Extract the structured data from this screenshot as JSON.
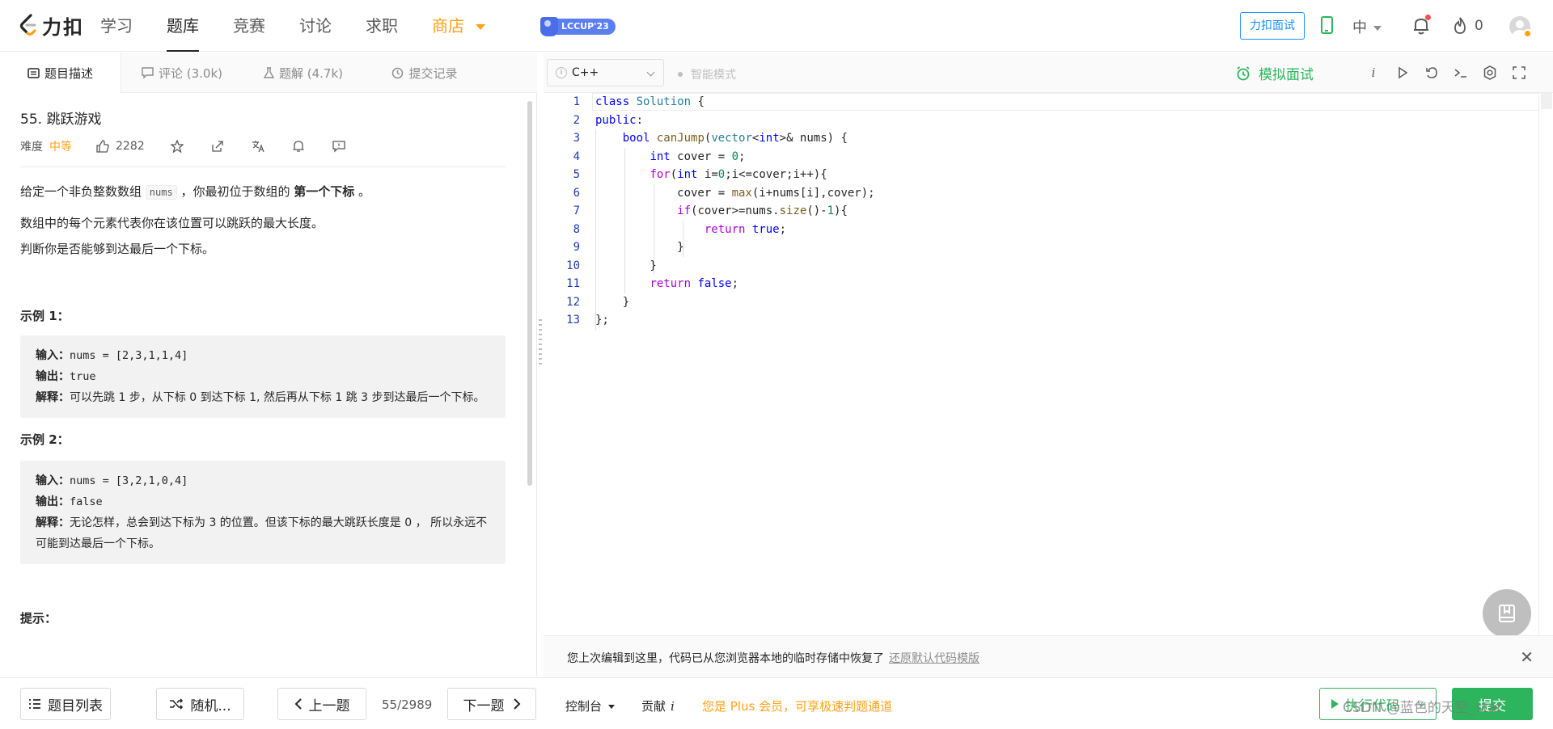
{
  "brand": {
    "name": "力扣"
  },
  "nav": {
    "links": [
      {
        "label": "学习"
      },
      {
        "label": "题库"
      },
      {
        "label": "竞赛"
      },
      {
        "label": "讨论"
      },
      {
        "label": "求职"
      },
      {
        "label": "商店"
      }
    ],
    "active_index": 1,
    "event_badge": "LCCUP'23",
    "interview_button": "力扣面试",
    "language_switch": "中",
    "flame_count": "0"
  },
  "left_tabs": [
    {
      "label": "题目描述",
      "icon": "description-icon"
    },
    {
      "label": "评论 (3.0k)",
      "icon": "comment-icon"
    },
    {
      "label": "题解 (4.7k)",
      "icon": "solution-flask-icon"
    },
    {
      "label": "提交记录",
      "icon": "history-clock-icon"
    }
  ],
  "problem": {
    "title": "55. 跳跃游戏",
    "difficulty_label": "难度",
    "difficulty": "中等",
    "likes": "2282",
    "desc_part1": "给定一个非负整数数组 ",
    "desc_code": "nums",
    "desc_part2": " ，你最初位于数组的 ",
    "desc_bold": "第一个下标",
    "desc_part3": " 。",
    "desc_line2": "数组中的每个元素代表你在该位置可以跳跃的最大长度。",
    "desc_line3": "判断你是否能够到达最后一个下标。",
    "examples": [
      {
        "title": "示例 1：",
        "input_label": "输入：",
        "input_value": "nums = [2,3,1,1,4]",
        "output_label": "输出：",
        "output_value": "true",
        "explain_label": "解释：",
        "explain_value": "可以先跳 1 步，从下标 0 到达下标 1, 然后再从下标 1 跳 3 步到达最后一个下标。"
      },
      {
        "title": "示例 2：",
        "input_label": "输入：",
        "input_value": "nums = [3,2,1,0,4]",
        "output_label": "输出：",
        "output_value": "false",
        "explain_label": "解释：",
        "explain_value": "无论怎样，总会到达下标为 3 的位置。但该下标的最大跳跃长度是 0 ， 所以永远不可能到达最后一个下标。"
      }
    ],
    "hints_title": "提示："
  },
  "editor": {
    "language": "C++",
    "smart_mode": "智能模式",
    "mock_interview": "模拟面试",
    "notice_text": "您上次编辑到这里，代码已从您浏览器本地的临时存储中恢复了",
    "notice_link": "还原默认代码模版"
  },
  "code_lines": [
    "class Solution {",
    "public:",
    "    bool canJump(vector<int>& nums) {",
    "        int cover = 0;",
    "        for(int i=0;i<=cover;i++){",
    "            cover = max(i+nums[i],cover);",
    "            if(cover>=nums.size()-1){",
    "                return true;",
    "            }",
    "        }",
    "        return false;",
    "    }",
    "};"
  ],
  "bottom": {
    "problem_list": "题目列表",
    "random": "随机...",
    "prev": "上一题",
    "count": "55/2989",
    "next": "下一题",
    "console": "控制台",
    "contribute": "贡献",
    "plus_msg": "您是 Plus 会员，可享极速判题通道",
    "run": "执行代码",
    "submit": "提交",
    "watermark": "CSDN @蓝色的天空_star"
  },
  "colors": {
    "accent_green": "#2db55d",
    "accent_orange": "#ffa116",
    "link_blue": "#1a90ff"
  }
}
